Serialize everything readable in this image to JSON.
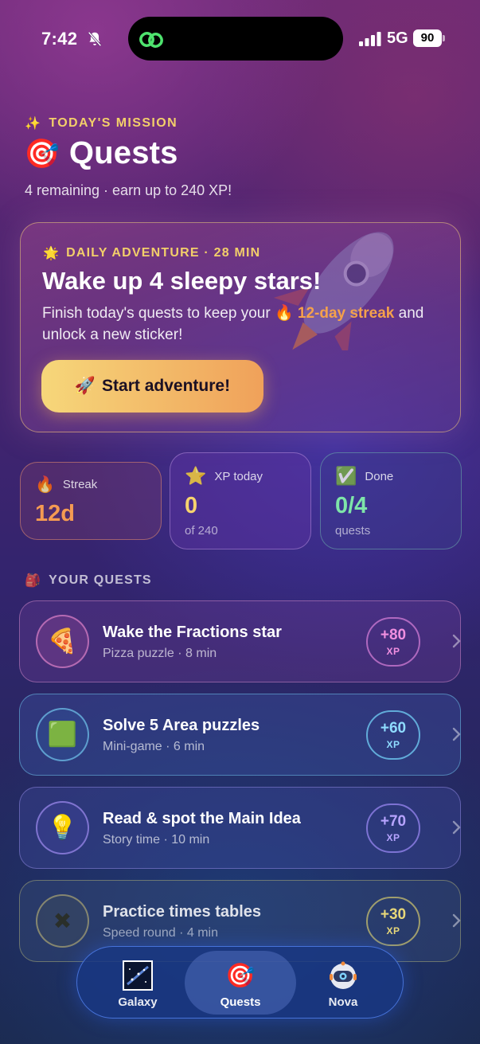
{
  "status_bar": {
    "time": "7:42",
    "network": "5G",
    "battery": "90"
  },
  "header": {
    "mission_label": "TODAY'S MISSION",
    "mission_emoji": "✨",
    "title_emoji": "🎯",
    "title": "Quests",
    "subtitle": "4 remaining · earn up to 240 XP!"
  },
  "adventure": {
    "label_emoji": "🌟",
    "label": "DAILY ADVENTURE · 28 MIN",
    "title": "Wake up 4 sleepy stars!",
    "desc_before": "Finish today's quests to keep your ",
    "streak_text": "🔥 12-day streak",
    "desc_after": " and unlock a new sticker!",
    "button_emoji": "🚀",
    "button_label": "Start adventure!"
  },
  "stats": [
    {
      "emoji": "🔥",
      "label": "Streak",
      "value": "12d",
      "sub": ""
    },
    {
      "emoji": "⭐",
      "label": "XP today",
      "value": "0",
      "sub": "of 240"
    },
    {
      "emoji": "✅",
      "label": "Done",
      "value": "0/4",
      "sub": "quests"
    }
  ],
  "quests_section": {
    "emoji": "🎒",
    "label": "YOUR QUESTS"
  },
  "quests": [
    {
      "emoji": "🍕",
      "title": "Wake the Fractions star",
      "sub": "Pizza puzzle · 8 min",
      "xp": "+80",
      "xp_unit": "XP"
    },
    {
      "emoji": "🟩",
      "title": "Solve 5 Area puzzles",
      "sub": "Mini-game · 6 min",
      "xp": "+60",
      "xp_unit": "XP"
    },
    {
      "emoji": "💡",
      "title": "Read & spot the Main Idea",
      "sub": "Story time · 10 min",
      "xp": "+70",
      "xp_unit": "XP"
    },
    {
      "emoji": "✖",
      "title": "Practice times tables",
      "sub": "Speed round · 4 min",
      "xp": "+30",
      "xp_unit": "XP"
    }
  ],
  "tabs": [
    {
      "emoji": "🌌",
      "label": "Galaxy"
    },
    {
      "emoji": "🎯",
      "label": "Quests"
    },
    {
      "emoji": "🤖",
      "label": "Nova"
    }
  ]
}
